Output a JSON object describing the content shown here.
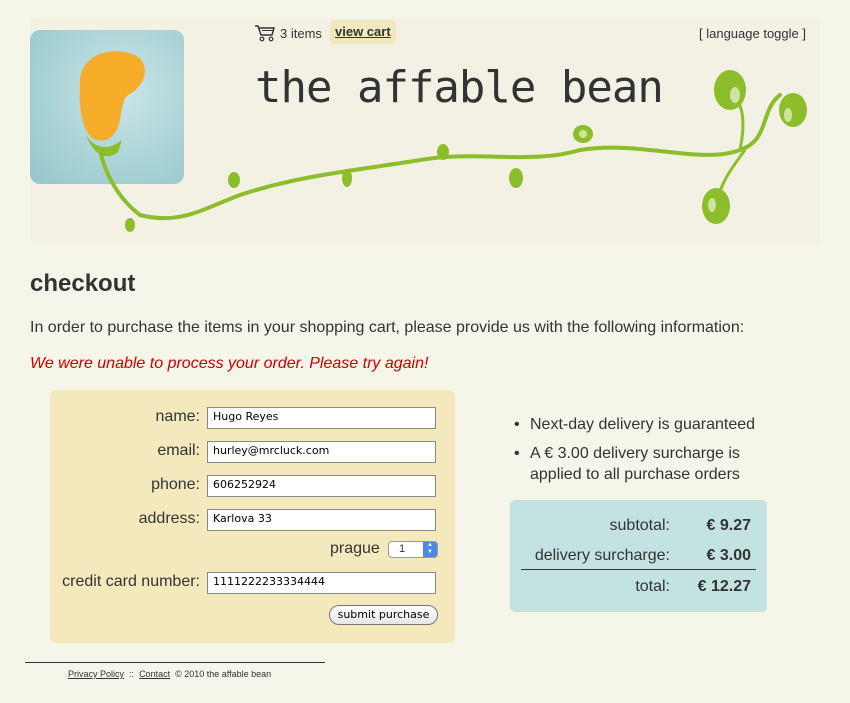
{
  "header": {
    "cart_count": "3 items",
    "view_cart_label": "view cart",
    "language_toggle": "[ language toggle ]",
    "site_title": "the affable bean"
  },
  "page": {
    "title": "checkout",
    "intro": "In order to purchase the items in your shopping cart, please provide us with the following information:",
    "error": "We were unable to process your order. Please try again!"
  },
  "form": {
    "name_label": "name:",
    "name_value": "Hugo Reyes",
    "email_label": "email:",
    "email_value": "hurley@mrcluck.com",
    "phone_label": "phone:",
    "phone_value": "606252924",
    "address_label": "address:",
    "address_value": "Karlova 33",
    "city_label": "prague",
    "district_value": "1",
    "cc_label": "credit card number:",
    "cc_value": "1111222233334444",
    "submit_label": "submit purchase"
  },
  "info": {
    "items": [
      "Next-day delivery is guaranteed",
      "A € 3.00 delivery surcharge is applied to all purchase orders"
    ]
  },
  "totals": {
    "subtotal_label": "subtotal:",
    "subtotal_value": "€ 9.27",
    "surcharge_label": "delivery surcharge:",
    "surcharge_value": "€ 3.00",
    "total_label": "total:",
    "total_value": "€ 12.27"
  },
  "footer": {
    "privacy": "Privacy Policy",
    "sep": "::",
    "contact": "Contact",
    "copyright": "©   2010 the affable bean"
  },
  "colors": {
    "background": "#f6f5e9",
    "form_panel": "#f4e8bd",
    "totals_panel": "#c3e3e1",
    "error": "#cc0000",
    "vine": "#8cbd2a",
    "bean": "#f7ad2a"
  },
  "icons": [
    "shopping-cart-icon",
    "bean-logo",
    "vine-decoration"
  ]
}
